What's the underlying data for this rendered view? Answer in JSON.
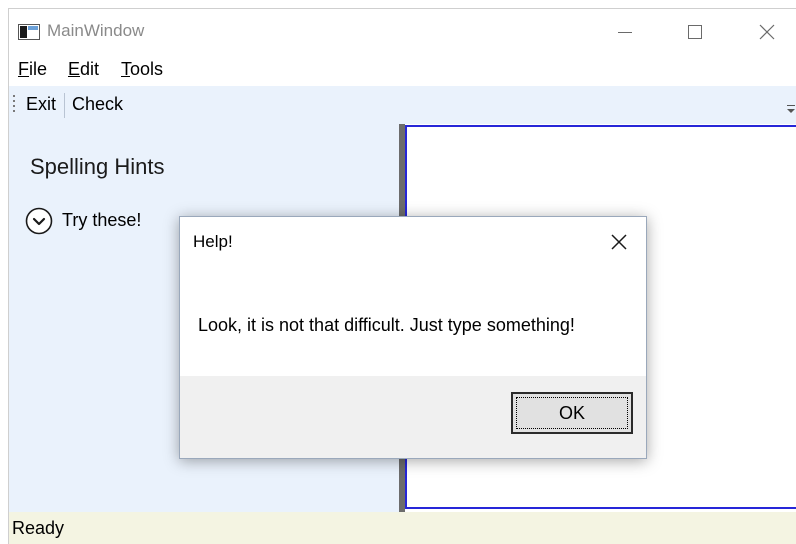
{
  "window": {
    "title": "MainWindow",
    "accent_color": "#2626d8"
  },
  "menu": {
    "items": [
      {
        "mnemonic": "F",
        "rest": "ile"
      },
      {
        "mnemonic": "E",
        "rest": "dit"
      },
      {
        "mnemonic": "T",
        "rest": "ools"
      }
    ]
  },
  "toolbar": {
    "exit_label": "Exit",
    "check_label": "Check"
  },
  "hints": {
    "title": "Spelling Hints",
    "expander_label": "Try these!",
    "expander_icon": "chevron-down-circle-icon"
  },
  "editor": {
    "value": ""
  },
  "status": {
    "text": "Ready"
  },
  "dialog": {
    "title": "Help!",
    "message": "Look, it is not that difficult. Just type something!",
    "ok_label": "OK"
  }
}
